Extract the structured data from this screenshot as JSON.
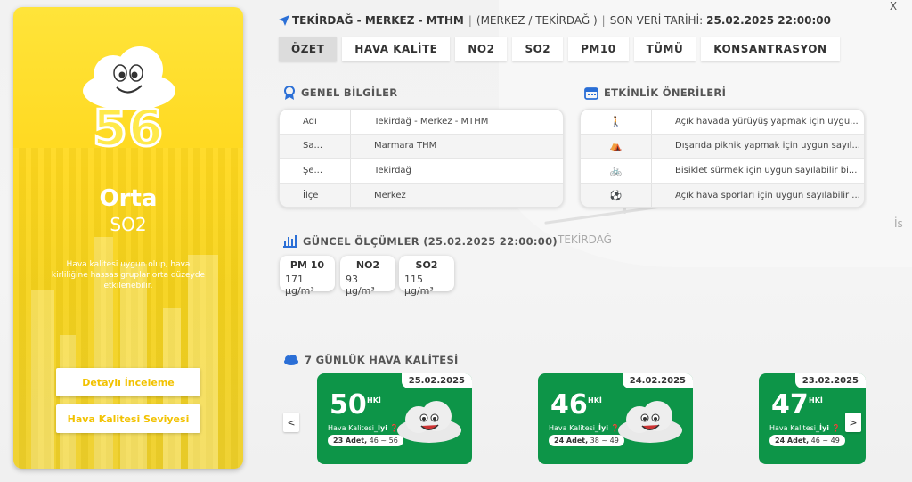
{
  "header": {
    "location_icon": "navigation-arrow-icon",
    "station": "TEKİRDAĞ - MERKEZ - MTHM",
    "region": "(MERKEZ / TEKİRDAĞ )",
    "last_label": "SON VERİ TARİHİ:",
    "last_date": "25.02.2025 22:00:00",
    "close": "X"
  },
  "tabs": [
    "ÖZET",
    "HAVA KALİTE",
    "NO2",
    "SO2",
    "PM10",
    "TÜMÜ",
    "KONSANTRASYON"
  ],
  "left": {
    "aqi": "56",
    "level": "Orta",
    "pollutant": "SO2",
    "description": "Hava kalitesi uygun olup, hava kirliliğine hassas gruplar orta düzeyde etkilenebilir.",
    "btn_detail": "Detaylı İnceleme",
    "btn_level": "Hava Kalitesi Seviyesi",
    "color": "#ffd81e"
  },
  "general": {
    "title": "GENEL BİLGİLER",
    "icon": "award-ribbon-icon",
    "rows": [
      {
        "k": "Adı",
        "v": "Tekirdağ - Merkez - MTHM"
      },
      {
        "k": "Sa...",
        "v": "Marmara THM"
      },
      {
        "k": "Şe...",
        "v": "Tekirdağ"
      },
      {
        "k": "İlçe",
        "v": "Merkez"
      }
    ]
  },
  "activities": {
    "title": "ETKİNLİK ÖNERİLERİ",
    "icon": "calendar-icon",
    "rows": [
      {
        "icon": "walking-icon",
        "glyph": "🚶",
        "v": "Açık havada yürüyüş yapmak için uygu..."
      },
      {
        "icon": "picnic-icon",
        "glyph": "⛺",
        "v": "Dışarıda piknik yapmak için uygun sayıl..."
      },
      {
        "icon": "bicycle-icon",
        "glyph": "🚲",
        "v": "Bisiklet sürmek için uygun sayılabilir bi..."
      },
      {
        "icon": "ball-icon",
        "glyph": "⚽",
        "v": "Açık hava sporları için uygun sayılabilir ..."
      }
    ]
  },
  "measurements": {
    "title": "GÜNCEL ÖLÇÜMLER (25.02.2025 22:00:00)",
    "icon": "bar-chart-icon",
    "items": [
      {
        "name": "PM 10",
        "value": "171 μg/m³"
      },
      {
        "name": "NO2",
        "value": "93 μg/m³"
      },
      {
        "name": "SO2",
        "value": "115 μg/m³"
      }
    ]
  },
  "weekly": {
    "title": "7 GÜNLÜK HAVA KALİTESİ",
    "icon": "cloud-icon",
    "prev": "<",
    "next": ">",
    "days": [
      {
        "date": "25.02.2025",
        "aqi": "50",
        "unit": "HKİ",
        "label": "Hava Kalitesi_",
        "level": "İyi",
        "count": "23 Adet,",
        "range": "46 ~ 56"
      },
      {
        "date": "24.02.2025",
        "aqi": "46",
        "unit": "HKİ",
        "label": "Hava Kalitesi_",
        "level": "İyi",
        "count": "24 Adet,",
        "range": "38 ~ 49"
      },
      {
        "date": "23.02.2025",
        "aqi": "47",
        "unit": "HKİ",
        "label": "Hava Kalitesi_",
        "level": "İyi",
        "count": "24 Adet,",
        "range": "46 ~ 49"
      }
    ],
    "color": "#0d9548"
  },
  "map": {
    "city": "TEKİRDAĞ",
    "edge_label": "İs"
  }
}
